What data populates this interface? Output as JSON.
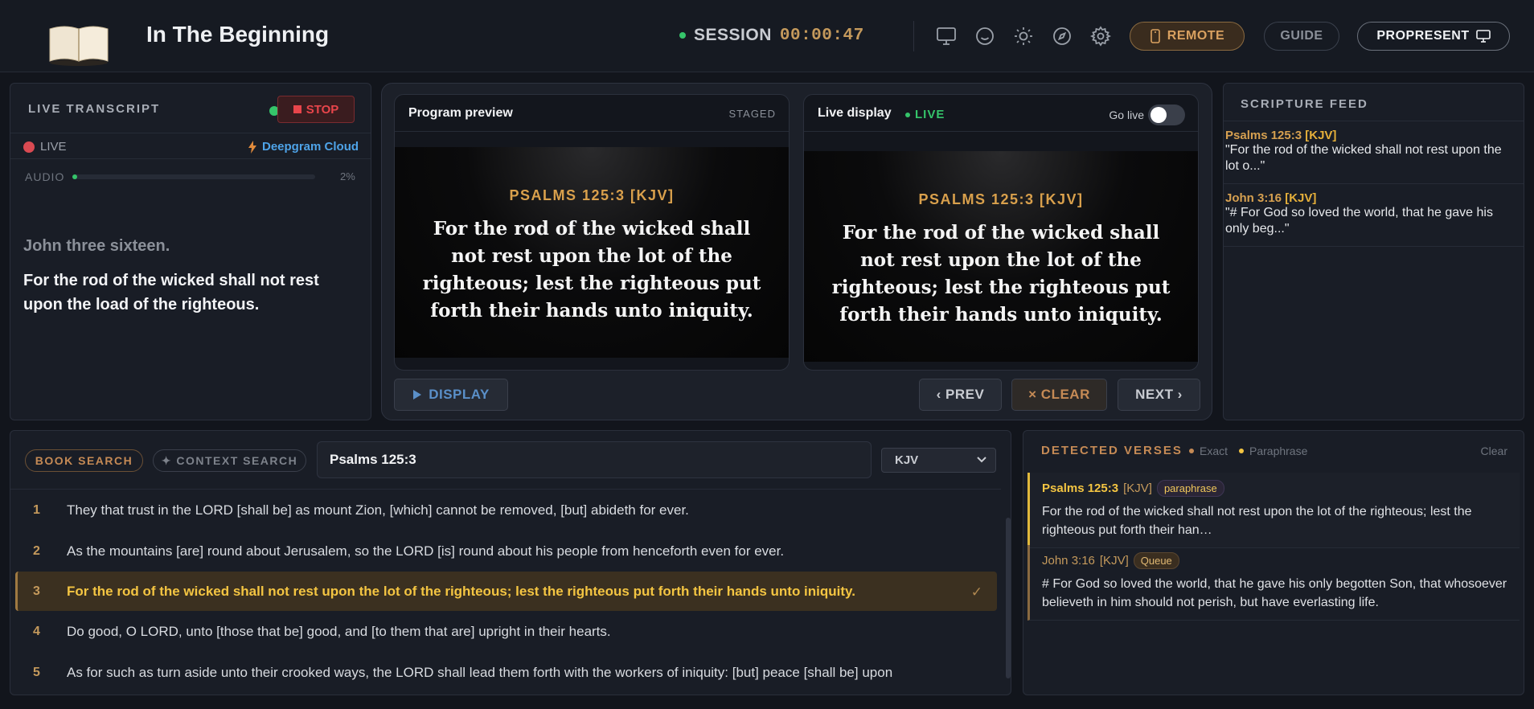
{
  "header": {
    "app_title": "In The Beginning",
    "session_label": "SESSION",
    "session_timer": "00:00:47",
    "icons": [
      "monitor-icon",
      "smiley-icon",
      "sun-icon",
      "compass-icon",
      "gear-icon"
    ],
    "remote_label": "REMOTE",
    "guide_label": "GUIDE",
    "propresent_label": "PROPRESENT"
  },
  "transcript": {
    "title": "LIVE TRANSCRIPT",
    "stop_label": "STOP",
    "live_label": "LIVE",
    "engine_label": "Deepgram Cloud",
    "audio_label": "AUDIO",
    "audio_level": 0.02,
    "audio_pct": "2%",
    "previous_line": "John three sixteen.",
    "current_line": "For the rod of the wicked shall not rest upon the load of the righteous."
  },
  "preview": {
    "program_title": "Program preview",
    "program_status": "STAGED",
    "program_ref": "PSALMS 125:3 [KJV]",
    "program_text": "For the rod of the wicked shall not rest upon the lot of the righteous; lest the righteous put forth their hands unto iniquity.",
    "live_title": "Live display",
    "live_badge": "LIVE",
    "golive_label": "Go live",
    "live_ref": "PSALMS 125:3 [KJV]",
    "live_text": "For the rod of the wicked shall not rest upon the lot of the righteous; lest the righteous put forth their hands unto iniquity.",
    "display_label": "DISPLAY",
    "prev_label": "‹ PREV",
    "clear_label": "× CLEAR",
    "next_label": "NEXT ›"
  },
  "feed": {
    "title": "SCRIPTURE FEED",
    "items": [
      {
        "ref": "Psalms 125:3",
        "version": "[KJV]",
        "text": "\"For the rod of the wicked shall not rest upon the lot o...\""
      },
      {
        "ref": "John 3:16",
        "version": "[KJV]",
        "text": "\"# For God so loved the world, that he gave his only beg...\""
      }
    ]
  },
  "search": {
    "book_search_label": "BOOK SEARCH",
    "context_search_label": "✦ CONTEXT SEARCH",
    "query": "Psalms 125:3",
    "version": "KJV",
    "verses": [
      {
        "num": "1",
        "text": "They that trust in the LORD [shall be] as mount Zion, [which] cannot be removed, [but] abideth for ever."
      },
      {
        "num": "2",
        "text": "As the mountains [are] round about Jerusalem, so the LORD [is] round about his people from henceforth even for ever."
      },
      {
        "num": "3",
        "text": "For the rod of the wicked shall not rest upon the lot of the righteous; lest the righteous put forth their hands unto iniquity."
      },
      {
        "num": "4",
        "text": "Do good, O LORD, unto [those that be] good, and [to them that are] upright in their hearts."
      },
      {
        "num": "5",
        "text": "As for such as turn aside unto their crooked ways, the LORD shall lead them forth with the workers of iniquity: [but] peace [shall be] upon"
      }
    ],
    "selected_check": "✓"
  },
  "detected": {
    "title": "DETECTED VERSES",
    "legend_exact": "Exact",
    "legend_paraphrase": "Paraphrase",
    "clear_label": "Clear",
    "items": [
      {
        "ref": "Psalms 125:3",
        "version": "[KJV]",
        "tag": "paraphrase",
        "text": "For the rod of the wicked shall not rest upon the lot of the righteous; lest the righteous put forth their han…"
      },
      {
        "ref": "John 3:16",
        "version": "[KJV]",
        "tag": "Queue",
        "text": "# For God so loved the world, that he gave his only begotten Son, that whosoever believeth in him should not perish, but have everlasting life."
      }
    ]
  },
  "colors": {
    "accent_gold": "#f4c542",
    "accent_copper": "#c58a55",
    "live_green": "#35c46a",
    "stop_red": "#e8454b",
    "link_blue": "#4ea3e8"
  }
}
